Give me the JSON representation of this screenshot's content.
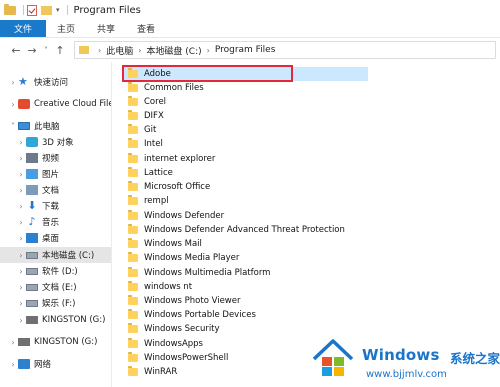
{
  "window": {
    "title": "Program Files"
  },
  "ribbon": {
    "tabs": [
      "文件",
      "主页",
      "共享",
      "查看"
    ]
  },
  "address": {
    "breadcrumbs": [
      "此电脑",
      "本地磁盘 (C:)",
      "Program Files"
    ]
  },
  "nav": {
    "items": [
      {
        "label": "快速访问",
        "icon": "star-icon"
      },
      {
        "label": "Creative Cloud Files",
        "icon": "creative-cloud-icon"
      },
      {
        "label": "此电脑",
        "icon": "computer-icon"
      },
      {
        "label": "3D 对象",
        "icon": "3d-objects-icon"
      },
      {
        "label": "视频",
        "icon": "video-icon"
      },
      {
        "label": "图片",
        "icon": "pictures-icon"
      },
      {
        "label": "文档",
        "icon": "documents-icon"
      },
      {
        "label": "下载",
        "icon": "download-icon"
      },
      {
        "label": "音乐",
        "icon": "music-icon"
      },
      {
        "label": "桌面",
        "icon": "desktop-icon"
      },
      {
        "label": "本地磁盘 (C:)",
        "icon": "drive-icon"
      },
      {
        "label": "软件 (D:)",
        "icon": "drive-icon"
      },
      {
        "label": "文档 (E:)",
        "icon": "drive-icon"
      },
      {
        "label": "娱乐 (F:)",
        "icon": "drive-icon"
      },
      {
        "label": "KINGSTON (G:)",
        "icon": "usb-drive-icon"
      },
      {
        "label": "KINGSTON (G:)",
        "icon": "usb-drive-icon"
      },
      {
        "label": "网络",
        "icon": "network-icon"
      }
    ]
  },
  "files": [
    "Adobe",
    "Common Files",
    "Corel",
    "DIFX",
    "Git",
    "Intel",
    "internet explorer",
    "Lattice",
    "Microsoft Office",
    "rempl",
    "Windows Defender",
    "Windows Defender Advanced Threat Protection",
    "Windows Mail",
    "Windows Media Player",
    "Windows Multimedia Platform",
    "windows nt",
    "Windows Photo Viewer",
    "Windows Portable Devices",
    "Windows Security",
    "WindowsApps",
    "WindowsPowerShell",
    "WinRAR"
  ],
  "watermark": {
    "brand": "Windows",
    "cn": "系统之家",
    "url": "www.bjjmlv.com"
  },
  "colors": {
    "accent": "#1979ca",
    "highlight": "#cce8ff",
    "callout": "#e0293d"
  }
}
